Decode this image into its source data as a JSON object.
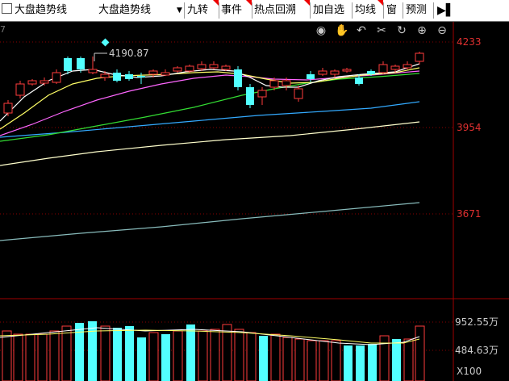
{
  "toolbar": {
    "checkbox_label": "大盘趋势线",
    "dropdown_value": "大盘趋势线",
    "items": [
      "九转",
      "事件",
      "热点回溯",
      "加自选",
      "均线",
      "窗",
      "预测"
    ]
  },
  "price_axis": {
    "labels": [
      "4233",
      "3954",
      "3671"
    ]
  },
  "high_marker": {
    "label": "4190.87"
  },
  "volume_axis": {
    "labels": [
      "952.55万",
      "484.63万"
    ],
    "multiplier": "X100"
  },
  "page_number": "7",
  "colors": {
    "up": "#ff3b3b",
    "down": "#52ffff",
    "axis_text": "#e03030",
    "ma5": "#ffffff",
    "ma10": "#ffff66",
    "ma20": "#ff66ff",
    "ma30": "#33dd33",
    "ma60": "#33aaff",
    "ma120": "#ffffcc",
    "ma250": "#88bbbb"
  },
  "icons": [
    "eye-icon",
    "hand-icon",
    "undo-icon",
    "scissors-icon",
    "refresh-icon",
    "zoom-in-icon",
    "zoom-out-icon"
  ]
}
